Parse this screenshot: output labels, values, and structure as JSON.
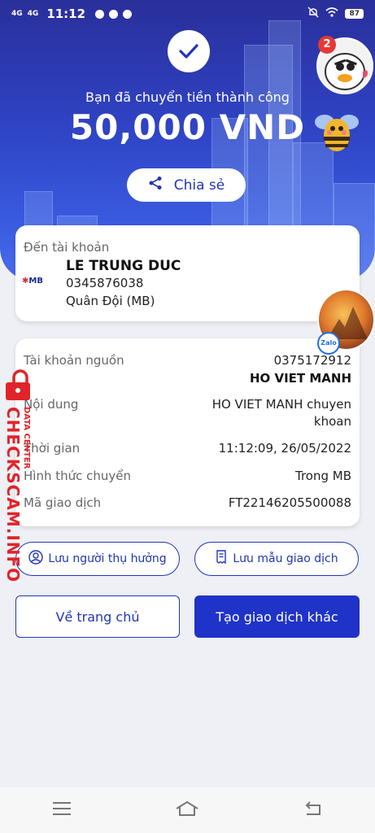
{
  "status_bar": {
    "signal_1": "4G",
    "signal_2": "4G",
    "time": "11:12",
    "battery": "87"
  },
  "hero": {
    "success_text": "Bạn đã chuyển tiền thành công",
    "amount": "50,000 VND",
    "share_label": "Chia sẻ",
    "notification_count": "2"
  },
  "recipient": {
    "label": "Đến tài khoản",
    "bank_logo": "MB",
    "name": "LE TRUNG DUC",
    "account": "0345876038",
    "bank": "Quân Đội (MB)"
  },
  "details": {
    "source_label": "Tài khoản nguồn",
    "source_account": "0375172912",
    "source_name": "HO VIET MANH",
    "content_label": "Nội dung",
    "content_line1": "HO VIET MANH chuyen",
    "content_line2": "khoan",
    "time_label": "Thời gian",
    "time_value": "11:12:09, 26/05/2022",
    "method_label": "Hình thức chuyển",
    "method_value": "Trong MB",
    "txn_label": "Mã giao dịch",
    "txn_value": "FT22146205500088"
  },
  "floating": {
    "zalo_label": "Zalo"
  },
  "actions": {
    "save_beneficiary": "Lưu người thụ hưởng",
    "save_template": "Lưu mẫu giao dịch",
    "home": "Về trang chủ",
    "new_transaction": "Tạo giao dịch khác"
  },
  "watermark": {
    "main": "CHECKSCAM.INFO",
    "sub": "DATA CENTER"
  },
  "colors": {
    "primary": "#1f33c8",
    "hero_top": "#2a2f9a",
    "watermark": "#e0242a"
  }
}
